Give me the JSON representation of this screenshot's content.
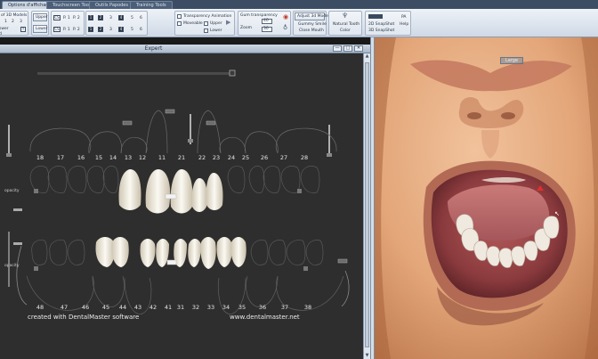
{
  "ribbon": {
    "tabs": [
      "Options d'affichage",
      "Touchscreen Tools",
      "Outils Papodes",
      "Training Tools"
    ],
    "models_label": "of 3D Models",
    "model_nums": [
      "1",
      "2",
      "3"
    ],
    "left_labels": [
      "swer",
      "d"
    ],
    "upper_label": "Upper",
    "lower_label": "Lower",
    "p_labels": [
      "P. 1",
      "P. 2"
    ],
    "cs_label": "CS",
    "num_row": [
      "1",
      "2",
      "3",
      "4",
      "5",
      "6"
    ],
    "transparency_animation": "Transparency Animation",
    "moveable": "Moveable",
    "upper_opt": "Upper",
    "lower_opt": "Lower",
    "gum_transparency": "Gum transparency",
    "zoom_label": "Zoom",
    "gum_value": "40",
    "zoom_value": "30",
    "adjust_3d": "Adjust 3d Model",
    "gummy_smile": "Gummy Smile",
    "close_mouth": "Close Mouth",
    "natural_tooth": "Natural Tooth",
    "color_label": "Color",
    "snapshot_2d": "2D SnapShot",
    "snapshot_3d": "3D SnapShot",
    "pa_label": "PA",
    "help_label": "Help"
  },
  "expert": {
    "title": "Expert",
    "btn_min": "—",
    "btn_max": "□",
    "btn_close": "✕",
    "upper_numbers": [
      "18",
      "17",
      "16",
      "15",
      "14",
      "13",
      "12",
      "11",
      "21",
      "22",
      "23",
      "24",
      "25",
      "26",
      "27",
      "28"
    ],
    "lower_numbers": [
      "48",
      "47",
      "46",
      "45",
      "44",
      "43",
      "42",
      "41",
      "31",
      "32",
      "33",
      "34",
      "35",
      "36",
      "37",
      "38"
    ],
    "opacity_label": "opacity",
    "footer_left": "created with DentalMaster software",
    "footer_right": "www.dentalmaster.net"
  },
  "photo": {
    "label": "Large"
  },
  "colors": {
    "ribbon_blue": "#3c4d63",
    "canvas": "#2e2e2e",
    "marker_red": "#e0302b",
    "skin": "#d89a6c"
  }
}
